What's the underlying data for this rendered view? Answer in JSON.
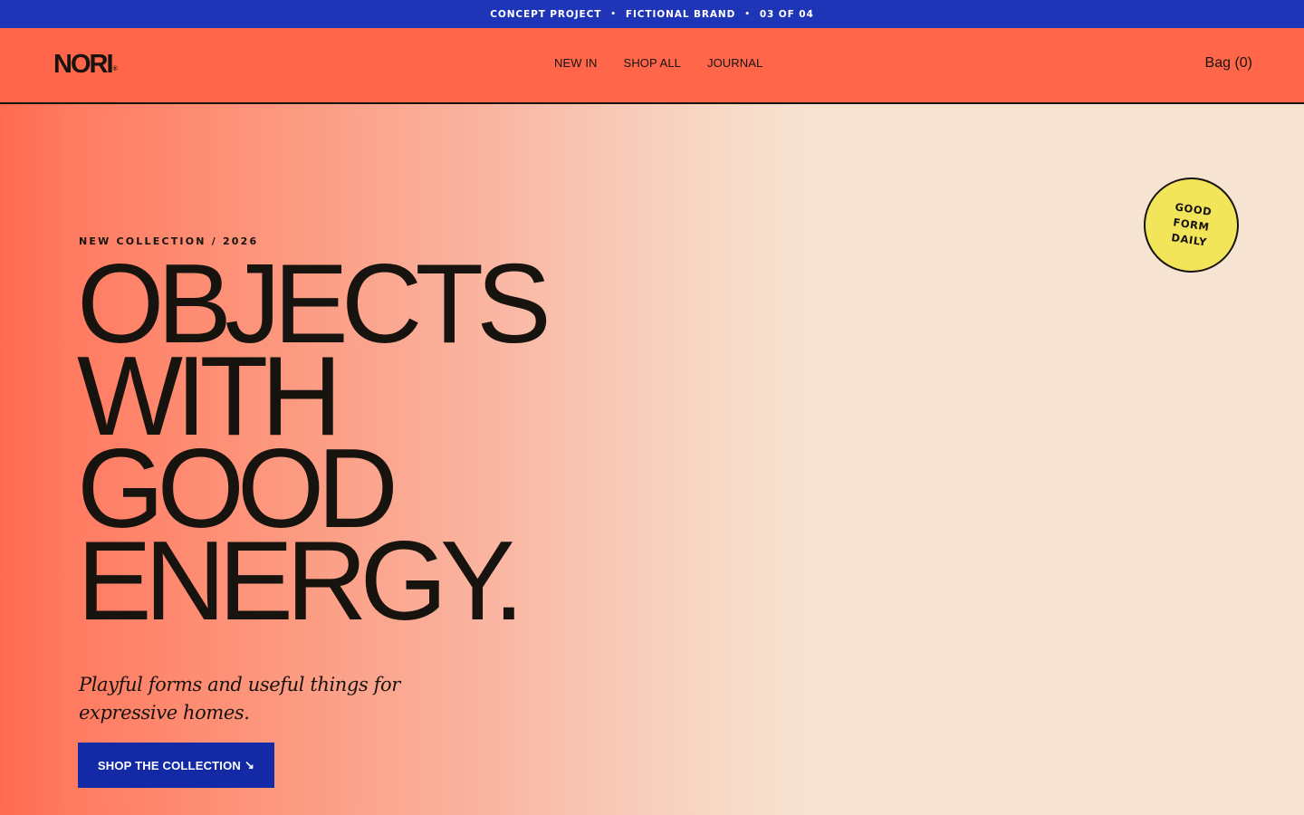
{
  "announcement": {
    "items": [
      "CONCEPT PROJECT",
      "FICTIONAL BRAND",
      "03 OF 04"
    ],
    "separator": "•"
  },
  "header": {
    "logo": "NORI",
    "logo_mark": "®",
    "nav": [
      "NEW IN",
      "SHOP ALL",
      "JOURNAL"
    ],
    "bag": "Bag (0)"
  },
  "hero": {
    "eyebrow": "NEW COLLECTION / 2026",
    "headline_lines": [
      "OBJECTS",
      "WITH",
      "GOOD",
      "ENERGY."
    ],
    "subcopy": "Playful forms and useful things for expressive homes.",
    "cta_label": "SHOP THE COLLECTION",
    "cta_arrow": "↘",
    "sticker_lines": [
      "GOOD",
      "FORM",
      "DAILY"
    ]
  },
  "colors": {
    "announcement_bg": "#1f35b8",
    "header_bg": "#ff664a",
    "hero_cream": "#f7e3d2",
    "cta_bg": "#1329a6",
    "sticker_bg": "#f3e55a",
    "ink": "#17130f"
  },
  "icons": {
    "cta_arrow": "arrow-down-right-icon"
  }
}
